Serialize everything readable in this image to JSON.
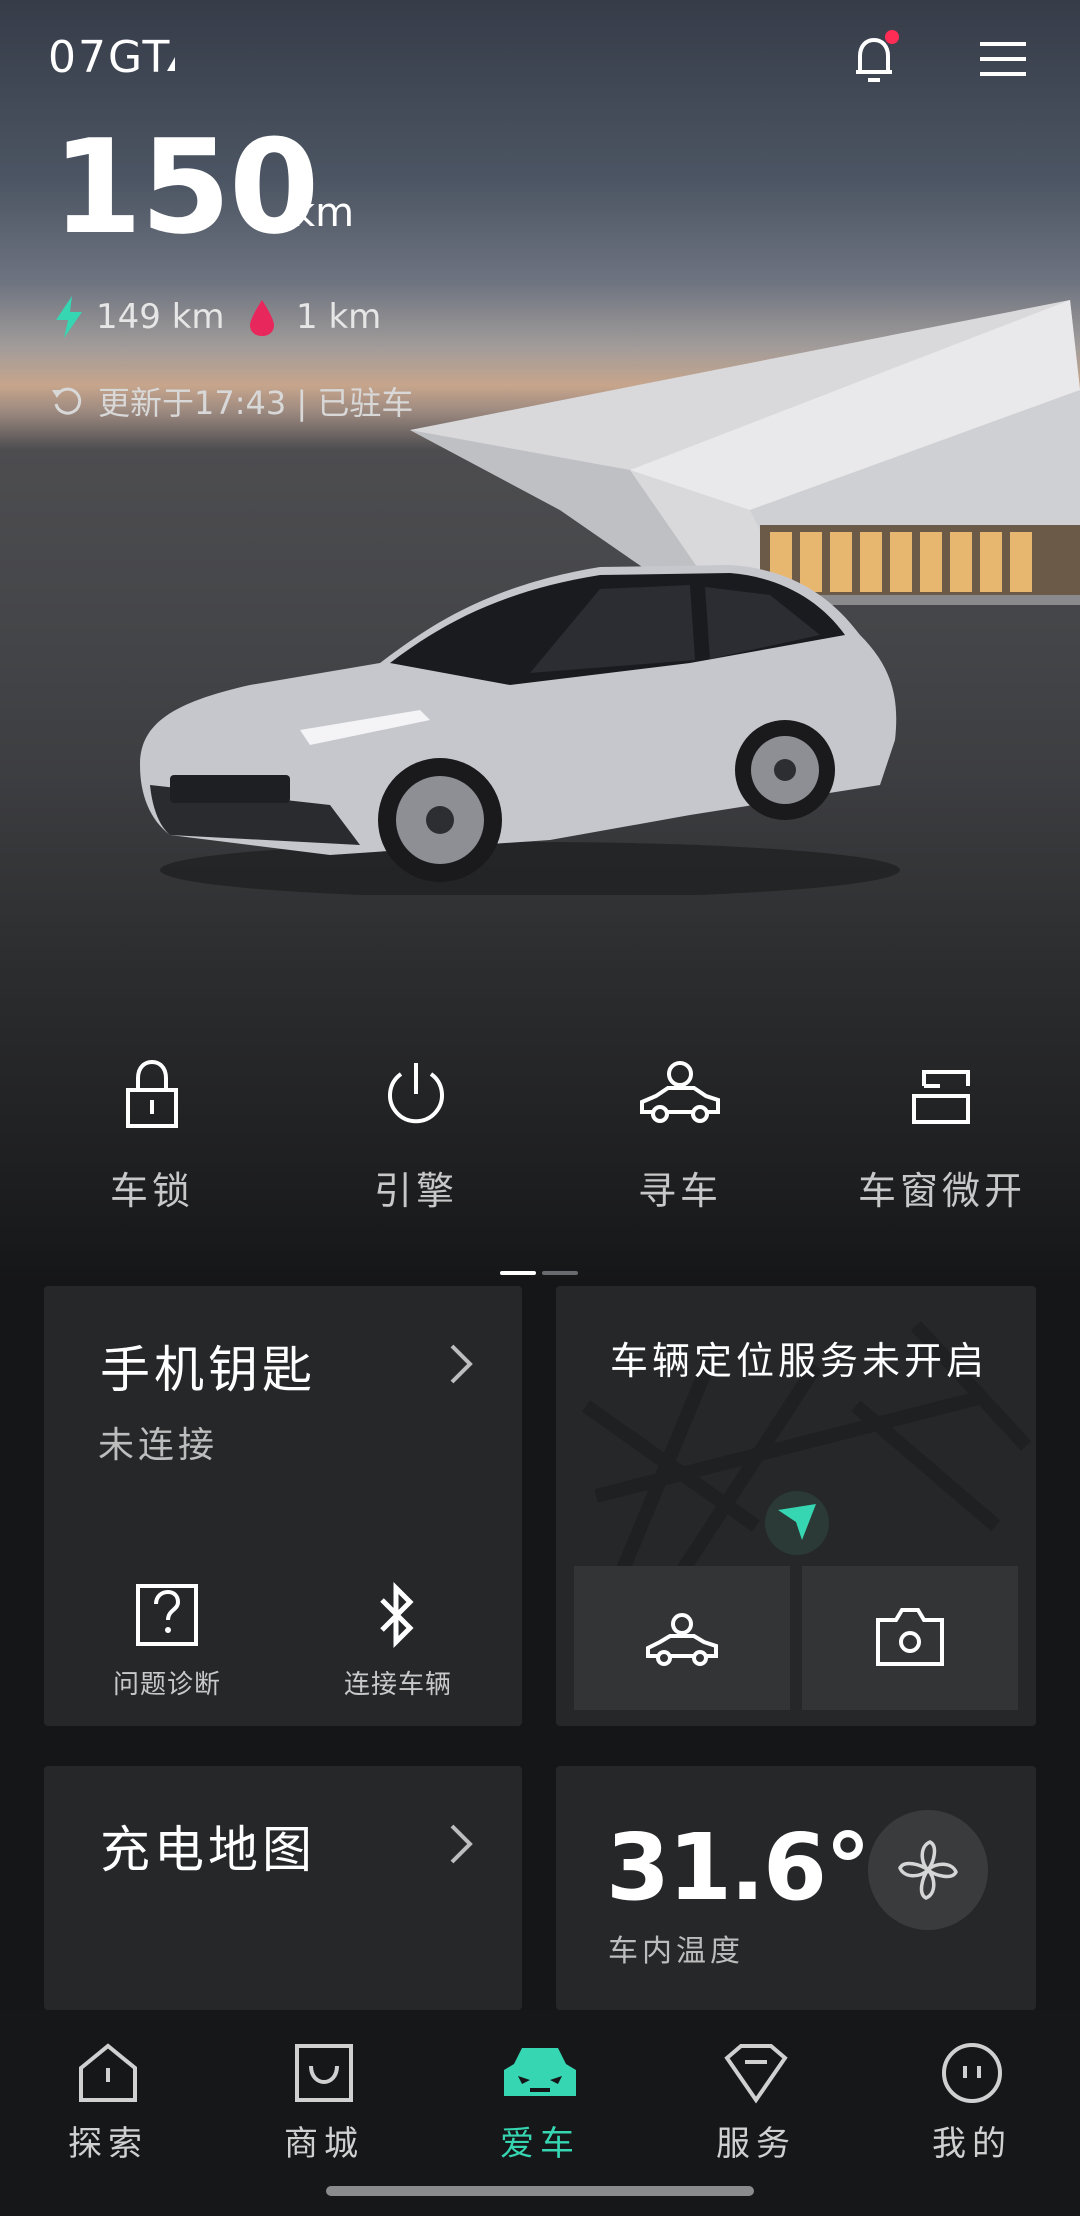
{
  "header": {
    "car_name": "07GT",
    "range_value": "150",
    "range_unit": "km",
    "electric_range": "149 km",
    "fuel_range": "1 km",
    "update_status": "更新于17:43 | 已驻车",
    "notification_dot_color": "#ff2d55"
  },
  "quick_actions": [
    {
      "label": "车锁",
      "icon": "lock-icon"
    },
    {
      "label": "引擎",
      "icon": "power-icon"
    },
    {
      "label": "寻车",
      "icon": "find-car-icon"
    },
    {
      "label": "车窗微开",
      "icon": "window-icon"
    }
  ],
  "phone_key_card": {
    "title": "手机钥匙",
    "status": "未连接",
    "diagnose_label": "问题诊断",
    "connect_label": "连接车辆"
  },
  "location_card": {
    "title": "车辆定位服务未开启"
  },
  "charging_card": {
    "title": "充电地图"
  },
  "temperature_card": {
    "value": "31.6°",
    "label": "车内温度"
  },
  "bottom_nav": [
    {
      "label": "探索",
      "icon": "explore-icon"
    },
    {
      "label": "商城",
      "icon": "shop-icon"
    },
    {
      "label": "爱车",
      "icon": "car-icon",
      "active": true
    },
    {
      "label": "服务",
      "icon": "service-icon"
    },
    {
      "label": "我的",
      "icon": "profile-icon"
    }
  ],
  "colors": {
    "accent": "#36d6b3",
    "electric": "#36d6b3",
    "fuel": "#e8285c",
    "card_bg": "#262729"
  }
}
